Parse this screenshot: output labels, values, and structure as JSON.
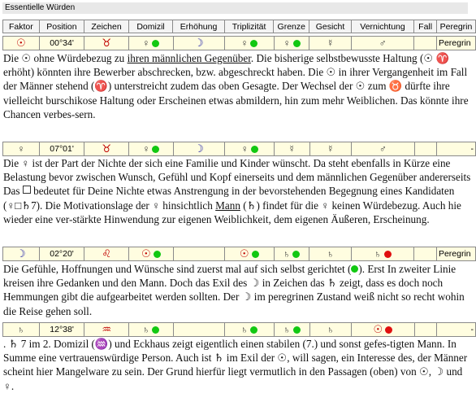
{
  "panel": {
    "title": "Essentielle Würden"
  },
  "header": [
    "Faktor",
    "Position",
    "Zeichen",
    "Domizil",
    "Erhöhung",
    "Triplizität",
    "Grenze",
    "Gesicht",
    "Vernichtung",
    "Fall",
    "Peregrin"
  ],
  "rows": [
    {
      "factor": "☉",
      "position": "00°34'",
      "sign": "♉",
      "domizil": "♀",
      "domizil_dot": "green",
      "erhoehung": "☽",
      "triplizitaet": "♀",
      "trip_dot": "green",
      "grenze": "♀",
      "grenze_dot": "green",
      "gesicht": "☿",
      "vernichtung": "♂",
      "fall": "",
      "peregrin": "Peregrin"
    },
    {
      "factor": "♀",
      "position": "07°01'",
      "sign": "♉",
      "domizil": "♀",
      "domizil_dot": "green",
      "erhoehung": "☽",
      "triplizitaet": "♀",
      "trip_dot": "green",
      "grenze": "☿",
      "grenze_dot": "",
      "gesicht": "☿",
      "vernichtung": "♂",
      "fall": "",
      "peregrin": "-"
    },
    {
      "factor": "☽",
      "position": "02°20'",
      "sign": "♌",
      "domizil": "☉",
      "domizil_dot": "green",
      "erhoehung": "",
      "triplizitaet": "☉",
      "trip_dot": "green",
      "grenze": "♄",
      "grenze_dot": "green",
      "gesicht": "♄",
      "vernichtung": "♄",
      "vern_dot": "red",
      "fall": "",
      "peregrin": "Peregrin"
    },
    {
      "factor": "♄",
      "position": "12°38'",
      "sign": "♒",
      "domizil": "♄",
      "domizil_dot": "green",
      "erhoehung": "",
      "triplizitaet": "♄",
      "trip_dot": "green",
      "grenze": "♄",
      "grenze_dot": "green",
      "gesicht": "♄",
      "vernichtung": "☉",
      "vern_dot": "red",
      "fall": "",
      "peregrin": "-"
    }
  ],
  "paragraphs": {
    "p1": {
      "a": "Die ☉ ohne Würdebezug zu ",
      "b": "ihren männlichen Gegenüber",
      "c": ". Die bisherige selbstbewusste Haltung (☉ ♈ erhöht) könnten ihre Bewerber abschrecken, bzw. abgeschreckt haben. Die ☉ in ihrer Vergangenheit im Fall der Männer stehend (♈) unterstreicht zudem das oben Gesagte. Der Wechsel der ☉ zum ♉ dürfte ihre vielleicht burschikose Haltung oder Erscheinen etwas abmildern, hin zum mehr Weiblichen. Das könnte ihre Chancen verbes-sern."
    },
    "p2": {
      "a": "Die ♀ ist der Part der Nichte der sich eine Familie und Kinder wünscht. Da steht ebenfalls in Kürze eine Belastung bevor zwischen Wunsch, Gefühl und Kopf einerseits und dem männlichen Gegenüber andererseits Das ",
      "box": "□",
      "b": " bedeutet für Deine Nichte etwas Anstrengung in der bevorstehenden Begegnung eines Kandidaten (♀□♄7). Die Motivationslage der ♀ hinsichtlich ",
      "mann": "Mann",
      "c": " (♄) findet für die ♀ keinen Würdebezug. Auch hie wieder eine ver-stärkte Hinwendung zur eigenen Weiblichkeit, dem eigenen Äußeren, Erscheinung."
    },
    "p3": {
      "a": "Die Gefühle, Hoffnungen und Wünsche sind zuerst mal auf sich selbst gerichtet (",
      "b": "). Erst In zweiter Linie kreisen ihre Gedanken und den Mann. Doch das Exil des ☽ in Zeichen das ♄ zeigt, dass es doch noch Hemmungen gibt die aufgearbeitet werden sollten. Der ☽ im peregrinen Zustand weiß nicht so recht wohin die Reise gehen soll."
    },
    "p4": {
      "a": ". ♄ 7 im 2. Domizil (♒) und Eckhaus zeigt eigentlich einen stabilen (7.) und sonst gefes-tigten Mann. In Summe eine vertrauenswürdige Person. Auch ist ♄ im Exil der ☉, will sagen, ein Interesse des, der Männer scheint hier Mangelware zu sein. Der Grund hierfür liegt vermutlich in den Passagen (oben) von ☉, ☽ und ♀."
    }
  }
}
